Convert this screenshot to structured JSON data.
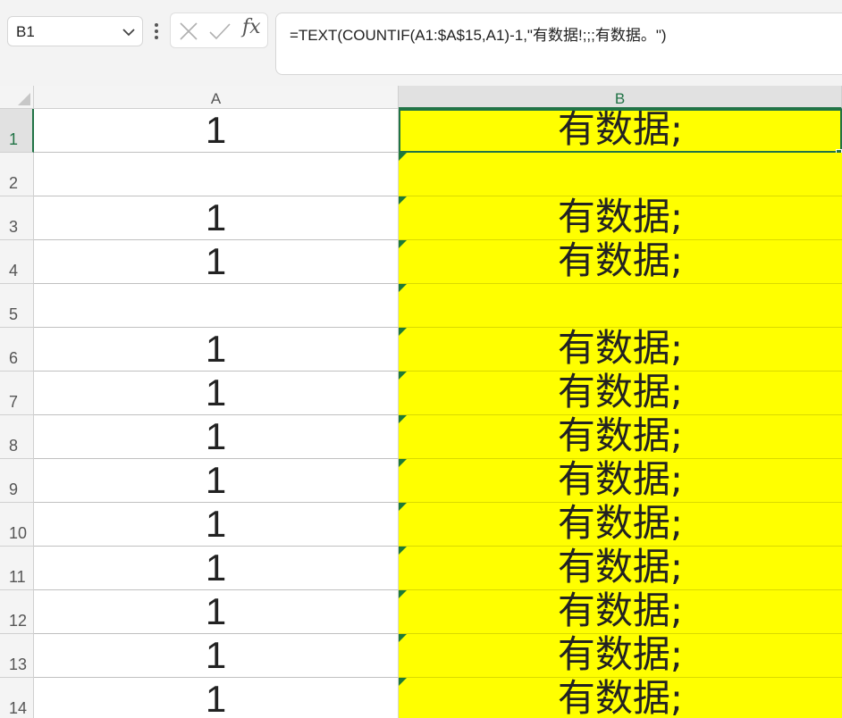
{
  "formula_bar": {
    "name_box": "B1",
    "fx_label": "fx",
    "formula": "=TEXT(COUNTIF(A1:$A$15,A1)-1,\"有数据!;;;有数据。\")"
  },
  "columns": [
    "A",
    "B"
  ],
  "rows": [
    {
      "num": "1",
      "a": "1",
      "b": "有数据;"
    },
    {
      "num": "2",
      "a": "",
      "b": ""
    },
    {
      "num": "3",
      "a": "1",
      "b": "有数据;"
    },
    {
      "num": "4",
      "a": "1",
      "b": "有数据;"
    },
    {
      "num": "5",
      "a": "",
      "b": ""
    },
    {
      "num": "6",
      "a": "1",
      "b": "有数据;"
    },
    {
      "num": "7",
      "a": "1",
      "b": "有数据;"
    },
    {
      "num": "8",
      "a": "1",
      "b": "有数据;"
    },
    {
      "num": "9",
      "a": "1",
      "b": "有数据;"
    },
    {
      "num": "10",
      "a": "1",
      "b": "有数据;"
    },
    {
      "num": "11",
      "a": "1",
      "b": "有数据;"
    },
    {
      "num": "12",
      "a": "1",
      "b": "有数据;"
    },
    {
      "num": "13",
      "a": "1",
      "b": "有数据;"
    },
    {
      "num": "14",
      "a": "1",
      "b": "有数据;"
    }
  ],
  "colors": {
    "highlight": "#ffff00",
    "accent": "#217346",
    "error_flag": "#1e7a37"
  },
  "icons": [
    "chevron-down-icon",
    "more-options-icon",
    "cancel-icon",
    "enter-icon",
    "fx-icon",
    "error-indicator-icon"
  ]
}
